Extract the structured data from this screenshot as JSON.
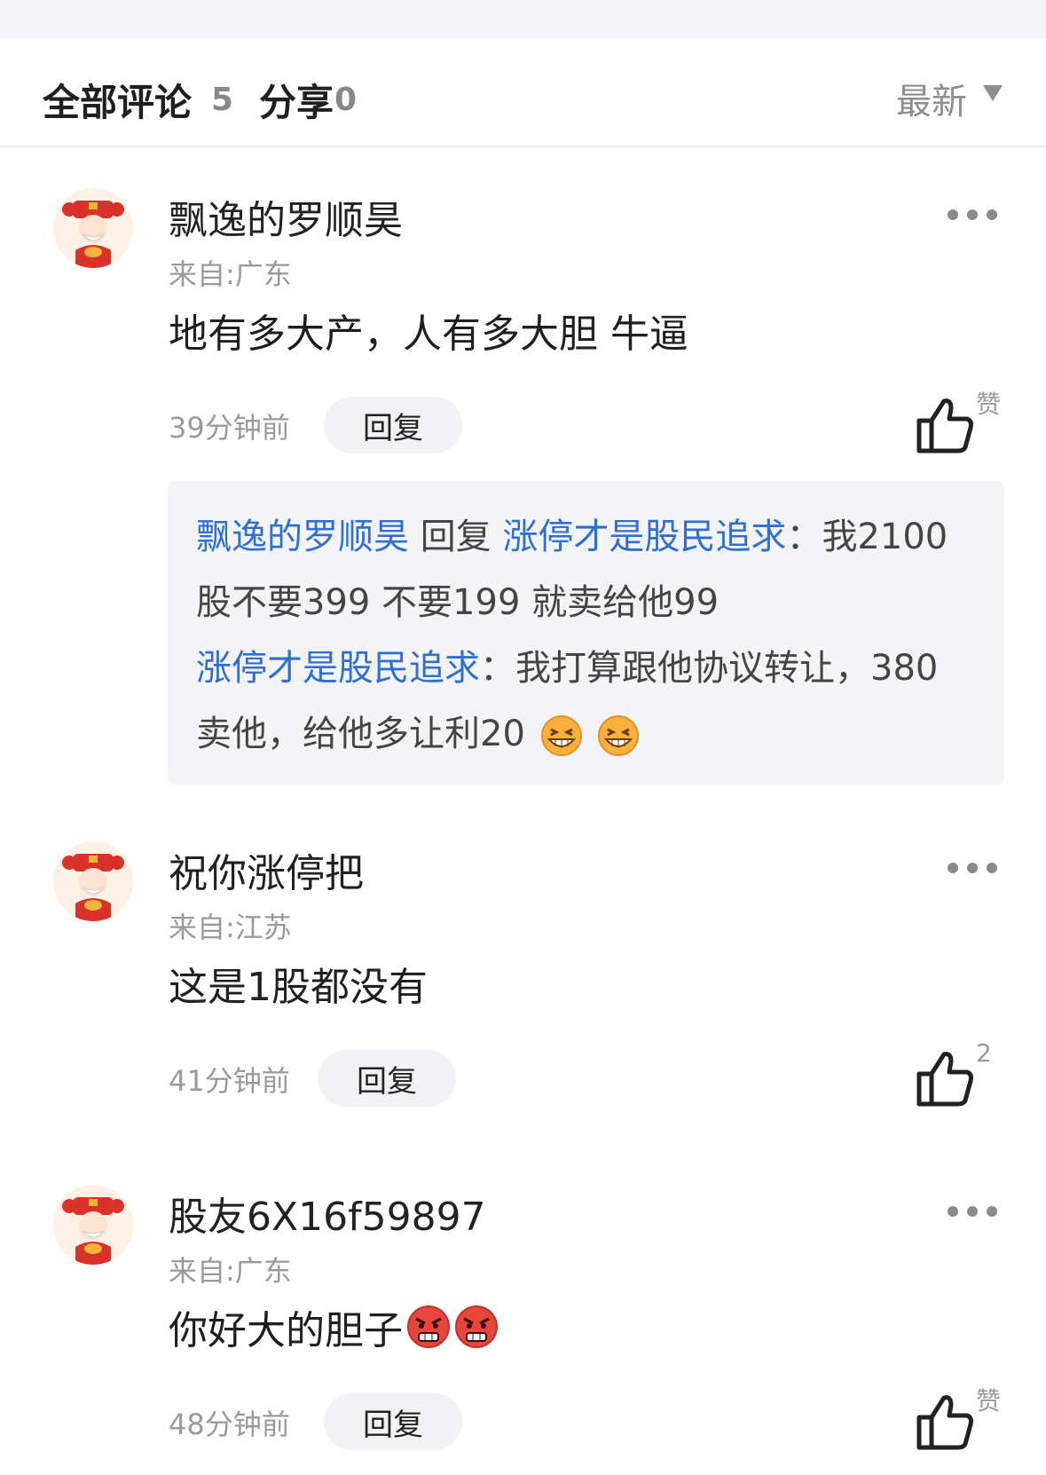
{
  "header": {
    "all_comments_label": "全部评论",
    "comments_count": "5",
    "share_label": "分享",
    "share_count": "0",
    "sort_label": "最新"
  },
  "comments": [
    {
      "username": "飘逸的罗顺昊",
      "location": "来自:广东",
      "content": "地有多大产，人有多大胆 牛逼",
      "time": "39分钟前",
      "reply_label": "回复",
      "like_label": "赞",
      "replies": [
        {
          "from": "飘逸的罗顺昊",
          "reply_word": "回复",
          "to": "涨停才是股民追求",
          "colon": "：",
          "text_line1": "我2100",
          "text_line2": "股不要399 不要199 就卖给他99"
        },
        {
          "from": "涨停才是股民追求",
          "colon": "：",
          "text_line1": "我打算跟他协议转让，380",
          "text_line2": "卖他，给他多让利20",
          "emojis": [
            "grin-emoji",
            "grin-emoji"
          ]
        }
      ]
    },
    {
      "username": "祝你涨停把",
      "location": "来自:江苏",
      "content": "这是1股都没有",
      "time": "41分钟前",
      "reply_label": "回复",
      "like_label": "2"
    },
    {
      "username": "股友6X16f59897",
      "location": "来自:广东",
      "content": "你好大的胆子",
      "content_emojis": [
        "angry-emoji",
        "angry-emoji"
      ],
      "time": "48分钟前",
      "reply_label": "回复",
      "like_label": "赞"
    }
  ],
  "colors": {
    "link_blue": "#2e6fcf",
    "muted_gray": "#9a9a9a",
    "reply_bg": "#f4f4f6"
  }
}
